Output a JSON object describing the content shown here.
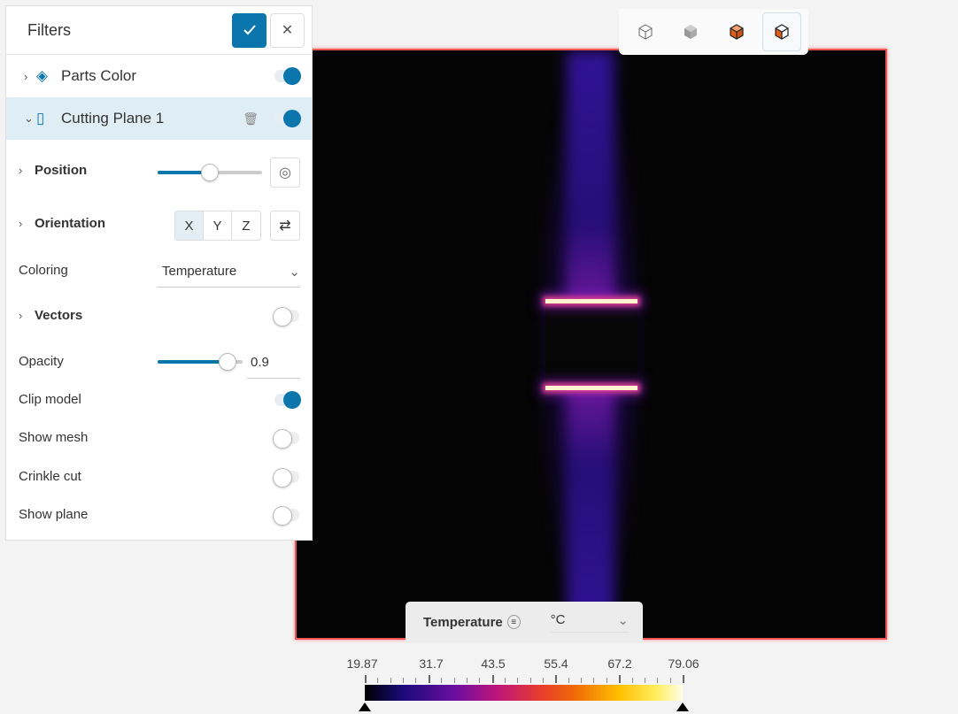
{
  "filters": {
    "title": "Filters",
    "items": [
      {
        "label": "Parts Color",
        "enabled": true
      },
      {
        "label": "Cutting Plane 1",
        "enabled": true
      }
    ]
  },
  "properties": {
    "position": {
      "label": "Position",
      "value": 0.5
    },
    "orientation": {
      "label": "Orientation",
      "options": [
        "X",
        "Y",
        "Z"
      ],
      "selected": "X"
    },
    "coloring": {
      "label": "Coloring",
      "value": "Temperature"
    },
    "vectors": {
      "label": "Vectors",
      "enabled": false
    },
    "opacity": {
      "label": "Opacity",
      "value": "0.9"
    },
    "clip_model": {
      "label": "Clip model",
      "enabled": true
    },
    "show_mesh": {
      "label": "Show mesh",
      "enabled": false
    },
    "crinkle_cut": {
      "label": "Crinkle cut",
      "enabled": false
    },
    "show_plane": {
      "label": "Show plane",
      "enabled": false
    }
  },
  "legend": {
    "title": "Temperature",
    "unit": "°C",
    "ticks": [
      "19.87",
      "31.7",
      "43.5",
      "55.4",
      "67.2",
      "79.06"
    ]
  },
  "colors": {
    "accent": "#0a76ac",
    "selection_border": "#e55555"
  }
}
